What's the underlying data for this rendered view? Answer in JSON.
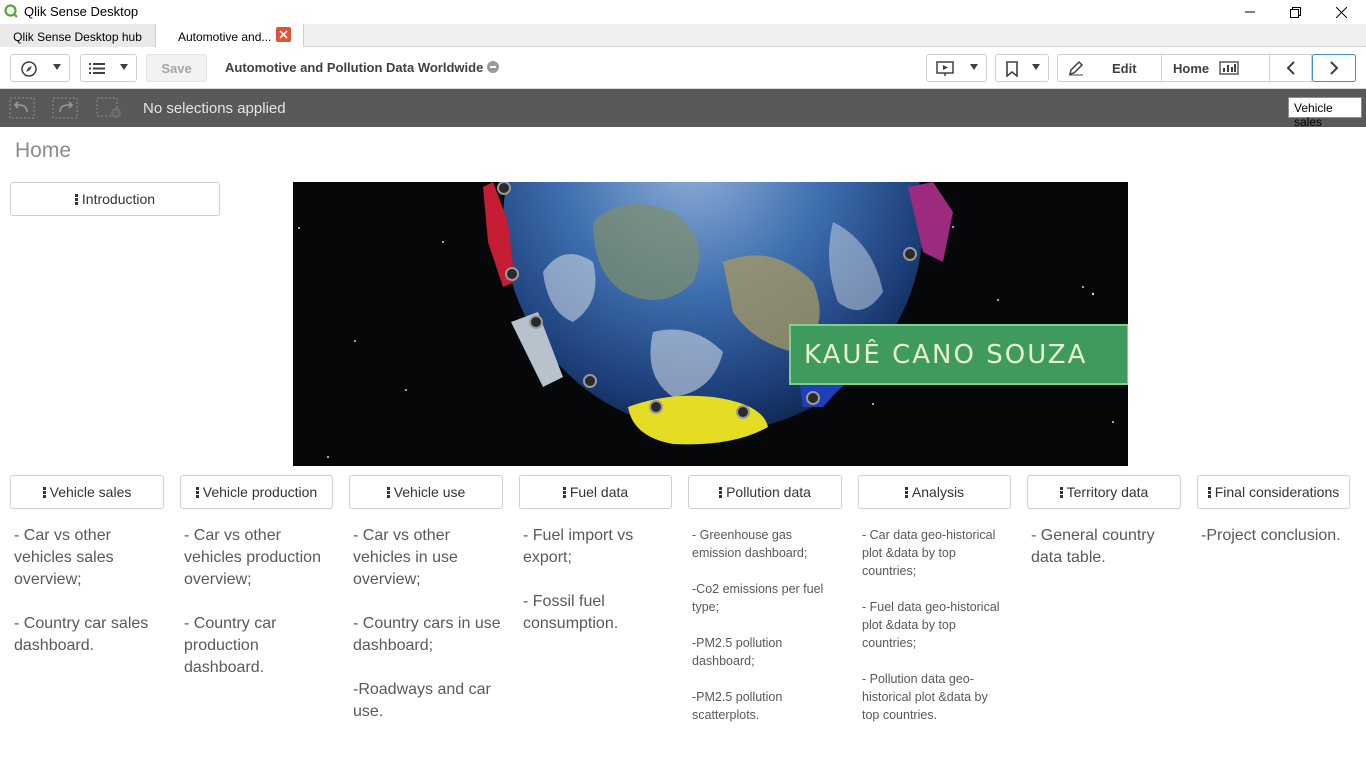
{
  "window": {
    "title": "Qlik Sense Desktop"
  },
  "tabs": [
    {
      "label": "Qlik Sense Desktop hub"
    },
    {
      "label": "Automotive and..."
    }
  ],
  "toolbar": {
    "save_label": "Save",
    "app_name": "Automotive and Pollution Data Worldwide",
    "edit_label": "Edit",
    "sheet_label": "Home"
  },
  "selections": {
    "text": "No selections applied"
  },
  "tooltip": {
    "text": "Vehicle sales"
  },
  "sheet": {
    "title": "Home",
    "intro_button": "Introduction",
    "banner_name": "KAUÊ CANO SOUZA",
    "sections": [
      {
        "button": "Vehicle sales",
        "text": "- Car vs other\nvehicles sales\noverview;\n\n- Country car sales\ndashboard."
      },
      {
        "button": "Vehicle production",
        "text": "- Car vs other\nvehicles production\noverview;\n\n- Country car\nproduction\ndashboard."
      },
      {
        "button": "Vehicle use",
        "text": "- Car vs other\nvehicles in use\noverview;\n\n- Country cars in use\ndashboard;\n\n-Roadways and car\nuse."
      },
      {
        "button": "Fuel data",
        "text": "- Fuel import vs\nexport;\n\n- Fossil fuel\nconsumption."
      },
      {
        "button": "Pollution data",
        "text": "- Greenhouse gas\nemission dashboard;\n\n-Co2 emissions per fuel\ntype;\n\n-PM2.5 pollution\ndashboard;\n\n-PM2.5 pollution\nscatterplots."
      },
      {
        "button": "Analysis",
        "text": "- Car data geo-historical\nplot &data by top\ncountries;\n\n- Fuel data geo-historical\nplot &data by top\ncountries;\n\n- Pollution data geo-\nhistorical plot &data by\ntop countries."
      },
      {
        "button": "Territory data",
        "text": "- General country\ndata table."
      },
      {
        "button": "Final considerations",
        "text": "-Project conclusion."
      }
    ]
  },
  "colors": {
    "accent": "#3f8fd2",
    "selection_bar": "#595959",
    "close_tab": "#e0513a",
    "banner_label": "#3f9a5e"
  }
}
